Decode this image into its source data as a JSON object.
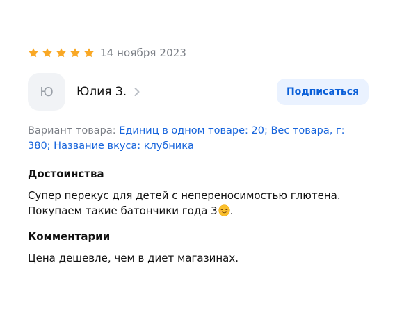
{
  "review": {
    "rating": 5,
    "rating_max": 5,
    "star_color": "#f9a825",
    "date": "14 ноября 2023",
    "author": {
      "initial": "Ю",
      "name": "Юлия З."
    },
    "subscribe_label": "Подписаться",
    "variant": {
      "label": "Вариант товара:",
      "value": "Единиц в одном товаре: 20; Вес товара, г: 380; Название вкуса: клубника"
    },
    "pros": {
      "title": "Достоинства",
      "text": "Супер перекус для детей с непереносимостью глютена. Покупаем такие батончики года 3",
      "emoji": "relieved-face-icon"
    },
    "comments": {
      "title": "Комментарии",
      "text": "Цена дешевле, чем в диет магазинах."
    }
  },
  "colors": {
    "accent": "#1865dc",
    "subscribe_bg": "#eaf2ff",
    "muted": "#7b7f86"
  }
}
